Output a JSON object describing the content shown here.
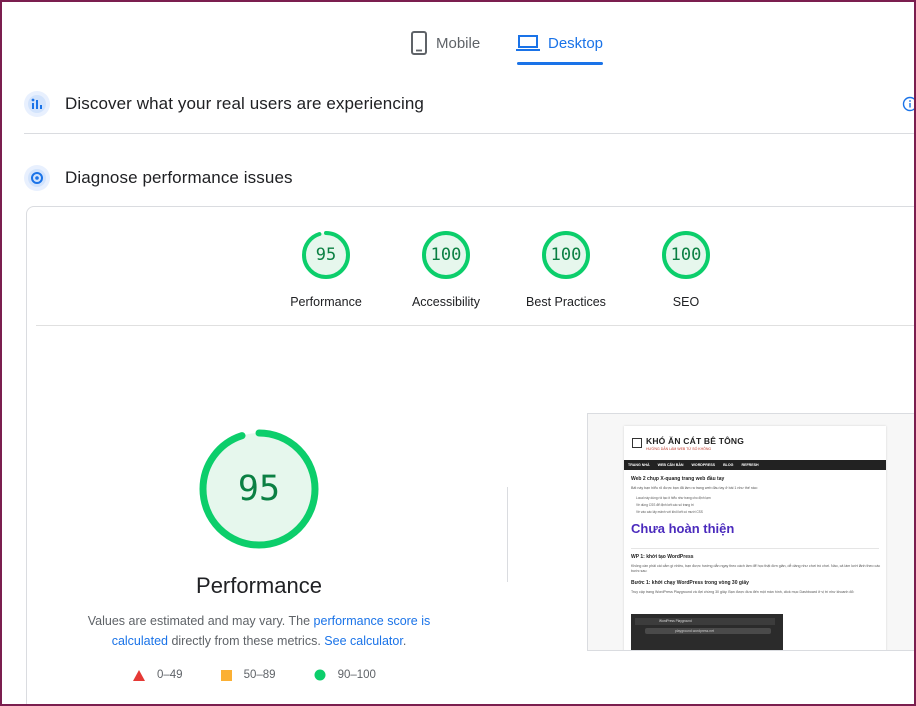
{
  "tabs": {
    "mobile": "Mobile",
    "desktop": "Desktop",
    "active": "desktop"
  },
  "sections": {
    "discover": "Discover what your real users are experiencing",
    "diagnose": "Diagnose performance issues"
  },
  "categories": [
    {
      "label": "Performance",
      "score": "95"
    },
    {
      "label": "Accessibility",
      "score": "100"
    },
    {
      "label": "Best Practices",
      "score": "100"
    },
    {
      "label": "SEO",
      "score": "100"
    }
  ],
  "performance": {
    "score": "95",
    "label": "Performance",
    "desc_prefix": "Values are estimated and may vary. The ",
    "link_score": "performance score is calculated",
    "desc_middle": " directly from these metrics. ",
    "link_calc": "See calculator",
    "desc_suffix": "."
  },
  "legend": [
    {
      "range": "0–49",
      "shape": "triangle",
      "color": "#e53935"
    },
    {
      "range": "50–89",
      "shape": "square",
      "color": "#fbb034"
    },
    {
      "range": "90–100",
      "shape": "circle",
      "color": "#0cce6b"
    }
  ],
  "colors": {
    "pass_stroke": "#0cce6b",
    "pass_fill": "#e6f7ed",
    "pass_text": "#0b8043",
    "accent": "#1a73e8"
  },
  "screenshot": {
    "site_name": "KHÓ ĂN CÁT BÊ TÔNG",
    "tagline": "HƯỚNG DẪN LÀM WEB TỪ SỐ KHÔNG",
    "nav": [
      "TRANG NHÀ",
      "WEB CĂN BẢN",
      "WORDPRESS",
      "BLOG",
      "REFRESH"
    ],
    "h1": "Web 2 chụp X-quang trang web đầu tay",
    "p1": "Bất này bạn hiểu rõ được bạn đã làm ra trang web đầu tay ở bài 1 như thế nào:",
    "li1": "Local này dùng rồi tạo ít hiểu như trang cho định lạm",
    "li2": "Về dùng CSS để định kết các số trang trí",
    "li3": "Về vào các lấy mảnh với khối kết có mười CSS",
    "big": "Chưa hoàn thiện",
    "h2": "WP 1: khởi tạo WordPress",
    "p2": "Không cần phải cài cắm gì nhiều, bạn được hướng dẫn ngay theo cách làm để học thật đơn giản, dễ dàng như chơi trò chơi. Nào, cả làm lướt lãnh theo các bước sau:",
    "h3": "Bước 1: khởi chạy WordPress trong vòng 30 giây",
    "p3": "Truy cập trang WordPress Playground và đợi chừng 30 giây. Bạn được đưa đến một màn hình, click mục Dashboard ở vị trí như khoanh đỏ:",
    "term_tab": "WordPress Playground",
    "term_url": "playground.wordpress.net"
  }
}
